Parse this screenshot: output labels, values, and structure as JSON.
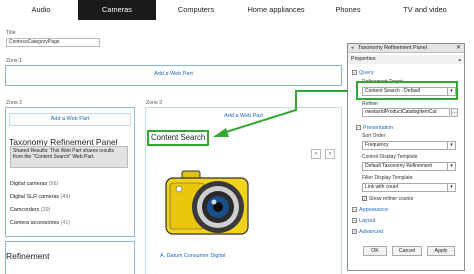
{
  "topnav": {
    "tabs": [
      {
        "label": "Audio"
      },
      {
        "label": "Cameras",
        "active": true
      },
      {
        "label": "Computers"
      },
      {
        "label": "Home appliances"
      },
      {
        "label": "Phones"
      },
      {
        "label": "TV and video"
      }
    ]
  },
  "title_field": {
    "label": "Title",
    "value": "ContosoCategoryPage"
  },
  "zone1": {
    "label": "Zone 1",
    "add_web_part": "Add a Web Part"
  },
  "zone2": {
    "label": "Zone 2",
    "add_web_part": "Add a Web Part",
    "panel_title": "Taxonomy Refinement Panel",
    "shared_results_note": "Shared Results: This Web Part shares results from the \"Content Search\" Web Part.",
    "refiners": [
      {
        "label": "Digital cameras",
        "count": "(56)"
      },
      {
        "label": "Digital SLR cameras",
        "count": "(49)"
      },
      {
        "label": "Camcorders",
        "count": "(29)"
      },
      {
        "label": "Camera accessories",
        "count": "(41)"
      }
    ],
    "refinement_heading": "Refinement"
  },
  "zone3": {
    "label": "Zone 3",
    "add_web_part": "Add a Web Part",
    "content_search_title": "Content Search",
    "pager": {
      "prev": "«",
      "next": "»"
    },
    "product_title": "A. Datum Consumer Digital"
  },
  "tool_pane": {
    "title": "Taxonomy Refinement Panel",
    "close": "✕",
    "properties_label": "Properties",
    "query_section": "Query",
    "refinement_target_label": "Refinement Target",
    "refinement_target_value": "Content Search - Default",
    "refiner_label": "Refiner",
    "refiner_value": "owstaxIdProductCatalogItemCat",
    "presentation_section": "Presentation",
    "sort_order_label": "Sort Order",
    "sort_order_value": "Frequency",
    "control_template_label": "Control Display Template",
    "control_template_value": "Default Taxonomy Refinement",
    "filter_template_label": "Filter Display Template",
    "filter_template_value": "Link with count",
    "show_counts_label": "Show refiner counts",
    "appearance_section": "Appearance",
    "layout_section": "Layout",
    "advanced_section": "Advanced",
    "ok": "OK",
    "cancel": "Cancel",
    "apply": "Apply"
  },
  "colors": {
    "highlight_green": "#34a634",
    "link_blue": "#1f66c2",
    "zone_border": "#8ab6e0",
    "camera_yellow": "#f2d21b"
  }
}
